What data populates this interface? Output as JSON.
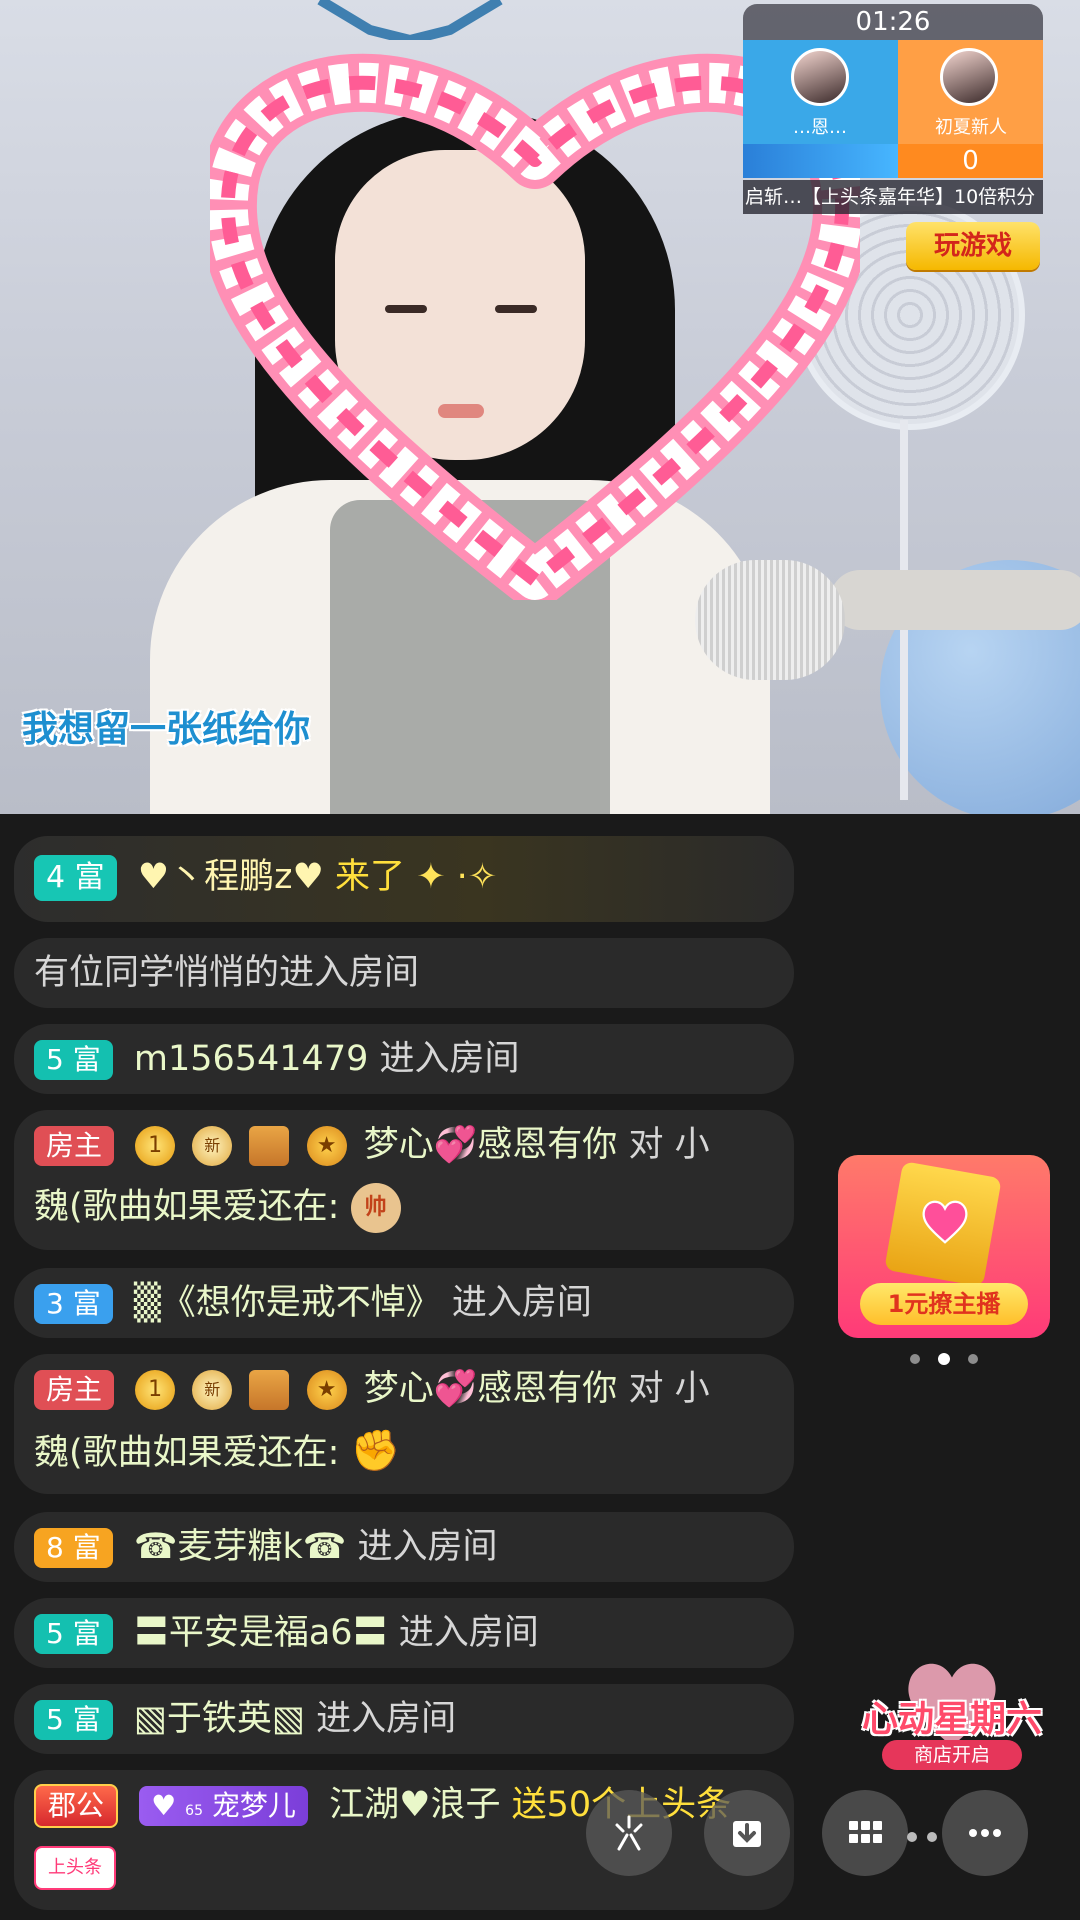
{
  "stream": {
    "lyric": "我想留一张纸给你",
    "heart_gift_label": "上头条"
  },
  "pk": {
    "timer": "01:26",
    "left_name": "…恩…",
    "right_name": "初夏新人",
    "right_score": "0",
    "banner": "启斩…【上头条嘉年华】10倍积分",
    "play_game_label": "玩游戏"
  },
  "chat": {
    "rows": [
      {
        "badge": "4 富",
        "user": "♥丶程鹏z♥",
        "action": "来了"
      },
      {
        "text": "有位同学悄悄的进入房间"
      },
      {
        "badge": "5 富",
        "user": "m156541479",
        "action": "进入房间"
      },
      {
        "badge": "房主",
        "icons": [
          "star-badge-icon",
          "new-noble-icon",
          "treasure-box-icon",
          "medal-icon"
        ],
        "user": "梦心💞感恩有你",
        "action": "对 小",
        "line2": "魏(歌曲如果爱还在:",
        "emoji": "帅"
      },
      {
        "badge": "3 富",
        "user": "▒《想你是戒不悼》",
        "action": "进入房间"
      },
      {
        "badge": "房主",
        "icons": [
          "star-badge-icon",
          "new-noble-icon",
          "treasure-box-icon",
          "medal-icon"
        ],
        "user": "梦心💞感恩有你",
        "action": "对 小",
        "line2": "魏(歌曲如果爱还在:",
        "emoji": "✊"
      },
      {
        "badge": "8 富",
        "user": "☎麦芽糖k☎",
        "action": "进入房间"
      },
      {
        "badge": "5 富",
        "user": "〓平安是福a6〓",
        "action": "进入房间"
      },
      {
        "badge": "5 富",
        "user": "▧于铁英▧",
        "action": "进入房间"
      },
      {
        "badge": "郡公",
        "fan_badge": "宠梦儿",
        "fan_level": "65",
        "user": "江湖♥浪子",
        "action": "送50个上头条",
        "gift_label": "上头条"
      }
    ]
  },
  "promo": {
    "label": "1元撩主播"
  },
  "event": {
    "title": "心动星期六",
    "subtitle": "商店开启"
  },
  "colors": {
    "rich_teal": "#14c0b0",
    "rich_blue": "#3aa0ee",
    "rich_orange": "#f7a421",
    "owner_red": "#e04f55",
    "gift_yellow": "#ffdf3c"
  }
}
